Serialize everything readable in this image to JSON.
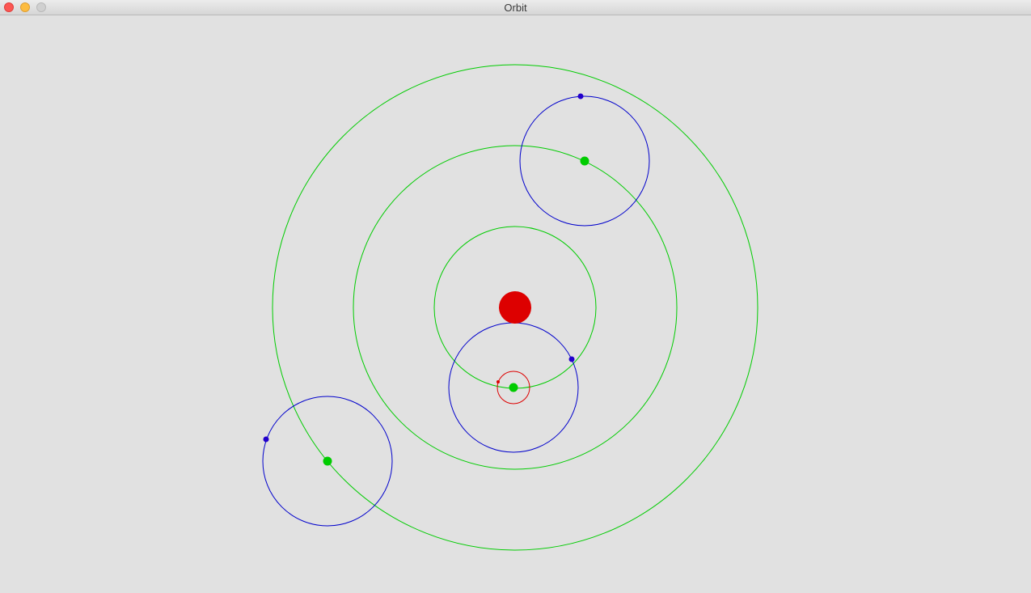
{
  "window": {
    "title": "Orbit"
  },
  "window_controls": {
    "close_icon": "close-icon",
    "minimize_icon": "minimize-icon",
    "zoom_icon": "zoom-icon"
  },
  "colors": {
    "background": "#e1e1e1",
    "sun": "#dd0000",
    "orbit_green": "#00cc00",
    "planet_green": "#00cc00",
    "orbit_blue": "#0000cc",
    "moon_blue": "#2200cc",
    "orbit_red": "#dd0000",
    "satellite_red": "#dd0000"
  },
  "scene": {
    "sun": {
      "name": "sun"
    },
    "planets": [
      {
        "name": "planet-inner",
        "moons": 1,
        "has_satellite": true
      },
      {
        "name": "planet-middle",
        "moons": 1
      },
      {
        "name": "planet-outer",
        "moons": 1
      }
    ]
  }
}
